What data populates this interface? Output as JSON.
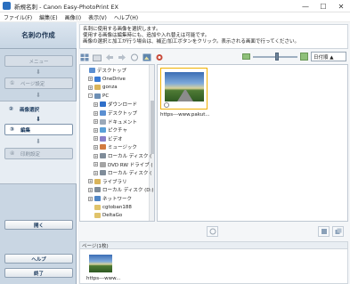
{
  "window": {
    "title": "新規名刺 - Canon Easy-PhotoPrint EX",
    "min": "—",
    "max": "☐",
    "close": "✕"
  },
  "menu": [
    "ファイル(F)",
    "編集(E)",
    "画像(I)",
    "表示(V)",
    "ヘルプ(H)"
  ],
  "sidebar": {
    "title": "名刺の作成",
    "steps": [
      {
        "num": "",
        "label": "メニュー"
      },
      {
        "num": "①",
        "label": "ページ設定"
      },
      {
        "num": "②",
        "label": "画像選択"
      },
      {
        "num": "③",
        "label": "編集"
      },
      {
        "num": "④",
        "label": "印刷設定"
      }
    ],
    "open_button": "開く",
    "help_button": "ヘルプ",
    "exit_button": "終了"
  },
  "instructions": [
    "名刺に使用する画像を選択します。",
    "使用する画像は編集時にも、追加や入れ替えは可能です。",
    "画像の選択と加工が行う場合は、補正/加工ボタンをクリック。表示される画面で行ってください。"
  ],
  "sort": {
    "value": "日付順 ▲"
  },
  "tree": [
    {
      "label": "デスクトップ",
      "indent": 0,
      "exp": "",
      "icon": "#5b8fd1"
    },
    {
      "label": "OneDrive",
      "indent": 1,
      "exp": "+",
      "icon": "#3a7bd5"
    },
    {
      "label": "gonza",
      "indent": 1,
      "exp": "+",
      "icon": "#d9b45a"
    },
    {
      "label": "PC",
      "indent": 1,
      "exp": "-",
      "icon": "#6d8fb5"
    },
    {
      "label": "ダウンロード",
      "indent": 2,
      "exp": "+",
      "icon": "#2f6fc9"
    },
    {
      "label": "デスクトップ",
      "indent": 2,
      "exp": "+",
      "icon": "#5b8fd1"
    },
    {
      "label": "ドキュメント",
      "indent": 2,
      "exp": "+",
      "icon": "#9aa9b9"
    },
    {
      "label": "ピクチャ",
      "indent": 2,
      "exp": "+",
      "icon": "#5aa0d8"
    },
    {
      "label": "ビデオ",
      "indent": 2,
      "exp": "+",
      "icon": "#8a7fc9"
    },
    {
      "label": "ミュージック",
      "indent": 2,
      "exp": "+",
      "icon": "#d27a3f"
    },
    {
      "label": "ローカル ディスク (",
      "indent": 2,
      "exp": "+",
      "icon": "#7f8c99"
    },
    {
      "label": "DVD RW ドライブ (",
      "indent": 2,
      "exp": "+",
      "icon": "#a4a4a4"
    },
    {
      "label": "ローカル ディスク (",
      "indent": 2,
      "exp": "+",
      "icon": "#7f8c99"
    },
    {
      "label": "ライブラリ",
      "indent": 1,
      "exp": "+",
      "icon": "#d9b45a"
    },
    {
      "label": "ローカル ディスク (D:)",
      "indent": 1,
      "exp": "+",
      "icon": "#7f8c99"
    },
    {
      "label": "ネットワーク",
      "indent": 1,
      "exp": "+",
      "icon": "#4f86c6"
    },
    {
      "label": "cgtoban188",
      "indent": 1,
      "exp": "",
      "icon": "#e0c36a"
    },
    {
      "label": "DeltaGo",
      "indent": 1,
      "exp": "",
      "icon": "#e0c36a"
    }
  ],
  "thumbnail": {
    "name": "https---www.pakut..."
  },
  "pages": {
    "label": "ページ(1枚)",
    "item_name": "https---www..."
  }
}
